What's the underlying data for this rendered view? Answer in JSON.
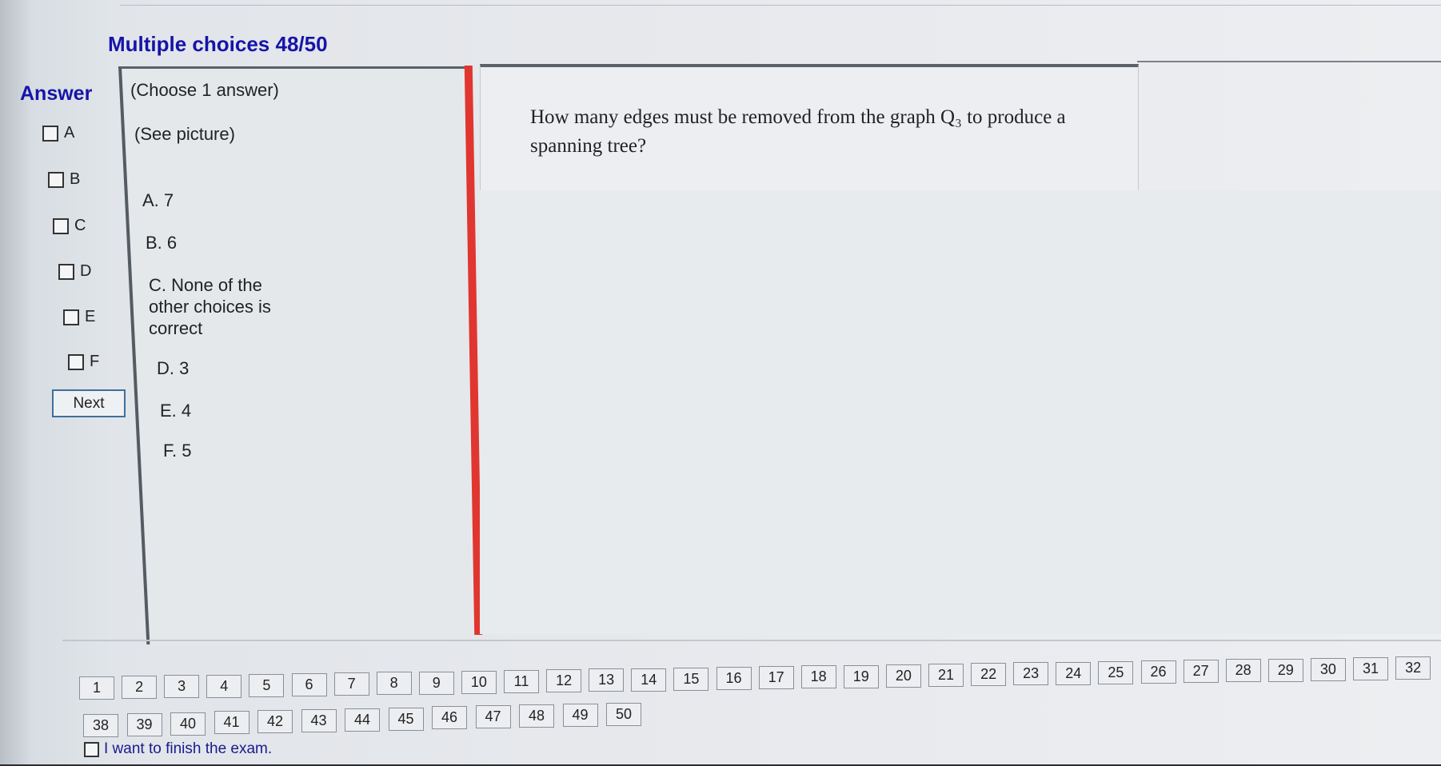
{
  "header": {
    "title": "Multiple choices 48/50"
  },
  "answer_panel": {
    "heading": "Answer",
    "options": [
      "A",
      "B",
      "C",
      "D",
      "E",
      "F"
    ],
    "next_label": "Next"
  },
  "choices": {
    "instruction": "(Choose 1 answer)",
    "see_picture": "(See picture)",
    "items": [
      "A. 7",
      "B. 6",
      "C. None of the other choices is correct",
      "D. 3",
      "E. 4",
      "F. 5"
    ]
  },
  "question": {
    "line1": "How many edges must be removed from the graph Q₃ to produce a",
    "line2": "spanning tree?"
  },
  "nav": {
    "row1": [
      "1",
      "2",
      "3",
      "4",
      "5",
      "6",
      "7",
      "8",
      "9",
      "10",
      "11",
      "12",
      "13",
      "14",
      "15",
      "16",
      "17",
      "18",
      "19",
      "20",
      "21",
      "22",
      "23",
      "24",
      "25",
      "26",
      "27",
      "28",
      "29",
      "30",
      "31",
      "32"
    ],
    "row2": [
      "38",
      "39",
      "40",
      "41",
      "42",
      "43",
      "44",
      "45",
      "46",
      "47",
      "48",
      "49",
      "50"
    ],
    "finish_label": "I want to finish the exam."
  }
}
